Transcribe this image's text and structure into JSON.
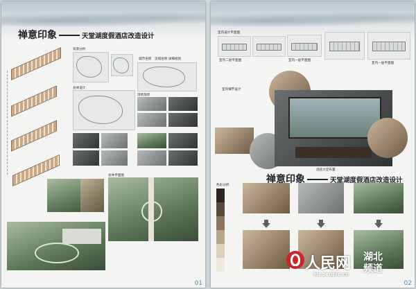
{
  "board1": {
    "title_main": "禅意印象",
    "title_sub": "天堂湖度假酒店改造设计",
    "section_site": "背景分析",
    "section_overall": "总体设计",
    "section_survey": "场地现状",
    "section_plan": "总体平面图",
    "location_note": "城市名称　流域名称 详细规划",
    "page_number": "01"
  },
  "board2": {
    "section_interior_plan": "室内设计平面图",
    "plan_caption_1": "室内二层平面图",
    "plan_caption_2": "室内一层平面图",
    "plan_caption_3": "室内一层平面图",
    "section_interior_design": "室内细节设计",
    "section_lobby": "酒店大堂布置",
    "title_main": "禅意印象",
    "title_sub": "天堂湖度假酒店改造设计",
    "section_color": "色彩分析",
    "page_number": "02",
    "swatch_colors": [
      "#2b2623",
      "#5a4a3d",
      "#8c7661",
      "#b9a58c",
      "#ddd0bd",
      "#efe8dc"
    ]
  },
  "watermark": {
    "brand_main": "人民网",
    "brand_region_top": "湖北",
    "brand_region_bottom": "频道",
    "url": "hb.people.cn"
  },
  "colors": {
    "accent_blue": "#4f8fb0",
    "logo_red": "#c8262a",
    "title_ink": "#1f2326"
  }
}
